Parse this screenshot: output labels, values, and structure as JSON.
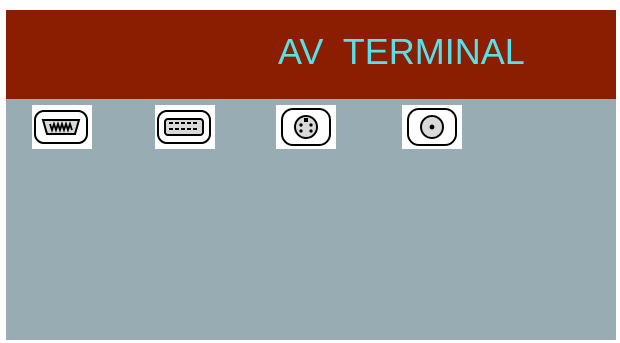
{
  "header": {
    "title": "AV  TERMINAL",
    "background_color": "#8b1e00",
    "title_color": "#56e0ea"
  },
  "panel": {
    "background_color": "#97adb3"
  },
  "ports": [
    {
      "icon": "dsub-vga-port-icon"
    },
    {
      "icon": "dsub-wide-port-icon"
    },
    {
      "icon": "s-video-port-icon"
    },
    {
      "icon": "rca-composite-port-icon"
    }
  ]
}
